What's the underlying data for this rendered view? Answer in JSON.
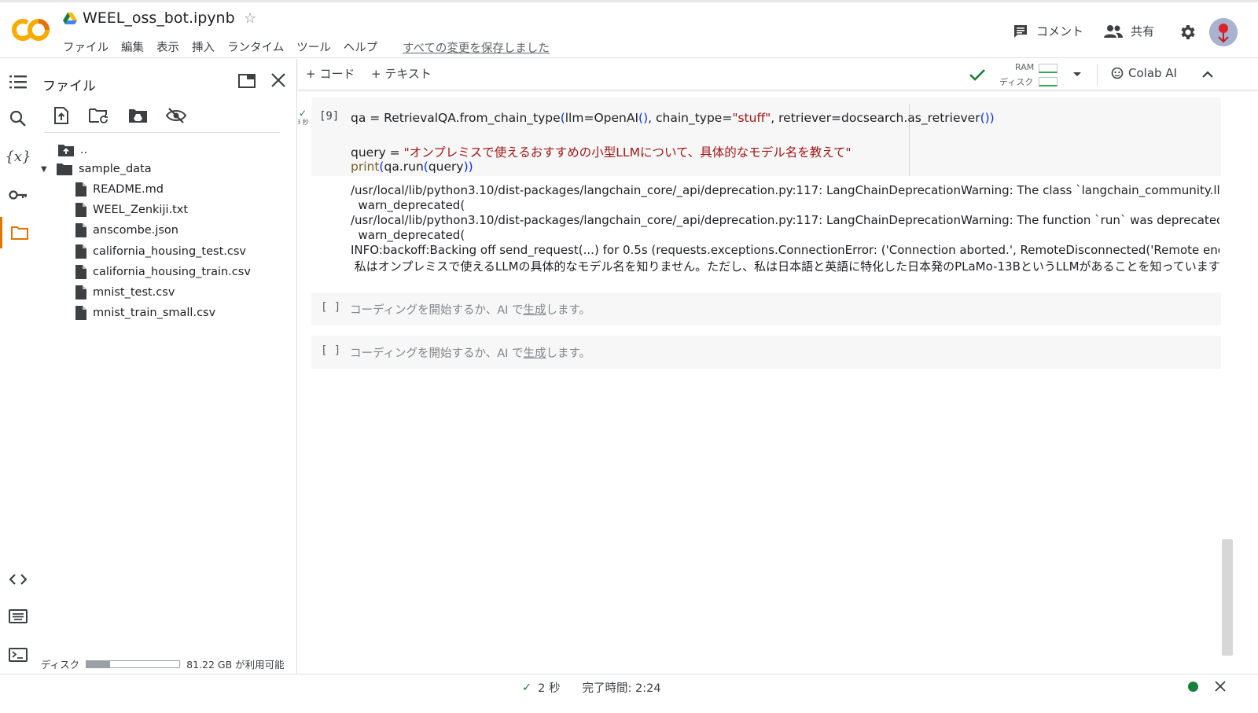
{
  "header": {
    "title": "WEEL_oss_bot.ipynb",
    "menu": [
      "ファイル",
      "編集",
      "表示",
      "挿入",
      "ランタイム",
      "ツール",
      "ヘルプ"
    ],
    "saved_status": "すべての変更を保存しました",
    "comment_label": "コメント",
    "share_label": "共有"
  },
  "rail": {
    "icons": [
      "toc-icon",
      "search-icon",
      "variables-icon",
      "key-icon",
      "folder-icon",
      "code-snippets-icon",
      "command-palette-icon",
      "terminal-icon"
    ],
    "active": "folder-icon"
  },
  "files": {
    "title": "ファイル",
    "toolbar_icons": [
      "upload-file-icon",
      "refresh-folder-icon",
      "mount-drive-icon",
      "hide-files-icon"
    ],
    "parent": "..",
    "folder": "sample_data",
    "items": [
      "README.md",
      "WEEL_Zenkiji.txt",
      "anscombe.json",
      "california_housing_test.csv",
      "california_housing_train.csv",
      "mnist_test.csv",
      "mnist_train_small.csv"
    ],
    "disk_label": "ディスク",
    "disk_available": "81.22 GB が利用可能",
    "disk_used_fraction": 0.25
  },
  "toolbar": {
    "add_code": "+ コード",
    "add_text": "+ テキスト",
    "ram_label": "RAM",
    "disk_label": "ディスク",
    "colab_ai": "Colab AI"
  },
  "cell1": {
    "exec_count": "[9]",
    "duration": "3 秒",
    "line1": {
      "a": "qa = RetrievalQA.from_chain_type",
      "b": "(",
      "c": "llm=OpenAI",
      "d": "()",
      "e": ", chain_type=",
      "f": "\"stuff\"",
      "g": ", retriever=docsearch.as_retriever",
      "h": "())"
    },
    "line2": {
      "a": "query = ",
      "b": "\"オンプレミスで使えるおすすめの小型LLMについて、具体的なモデル名を教えて\""
    },
    "line3": {
      "a": "print",
      "b": "(",
      "c": "qa.run",
      "d": "(",
      "e": "query",
      "f": "))"
    }
  },
  "output_lines": [
    "/usr/local/lib/python3.10/dist-packages/langchain_core/_api/deprecation.py:117: LangChainDeprecationWarning: The class `langchain_community.llms.openai.OpenAI` was deprecated",
    "  warn_deprecated(",
    "/usr/local/lib/python3.10/dist-packages/langchain_core/_api/deprecation.py:117: LangChainDeprecationWarning: The function `run` was deprecated in LangChain",
    "  warn_deprecated(",
    "INFO:backoff:Backing off send_request(...) for 0.5s (requests.exceptions.ConnectionError: ('Connection aborted.', RemoteDisconnected('Remote end closed connection",
    " 私はオンプレミスで使えるLLMの具体的なモデル名を知りません。ただし、私は日本語と英語に特化した日本発のPLaMo-13BというLLMがあることを知っています。他にもWe"
  ],
  "empty_cells": [
    {
      "bracket": "[ ]",
      "hint_a": "コーディングを開始するか、AI で",
      "hint_link": "生成",
      "hint_b": "します。"
    },
    {
      "bracket": "[ ]",
      "hint_a": "コーディングを開始するか、AI で",
      "hint_link": "生成",
      "hint_b": "します。"
    }
  ],
  "statusbar": {
    "elapsed": "2 秒",
    "completed": "完了時間: 2:24"
  },
  "colors": {
    "accent_orange": "#e37400",
    "logo_orange": "#f9ab00",
    "logo_orange_dark": "#e8710a",
    "success_green": "#188038",
    "string_red": "#a31515"
  }
}
